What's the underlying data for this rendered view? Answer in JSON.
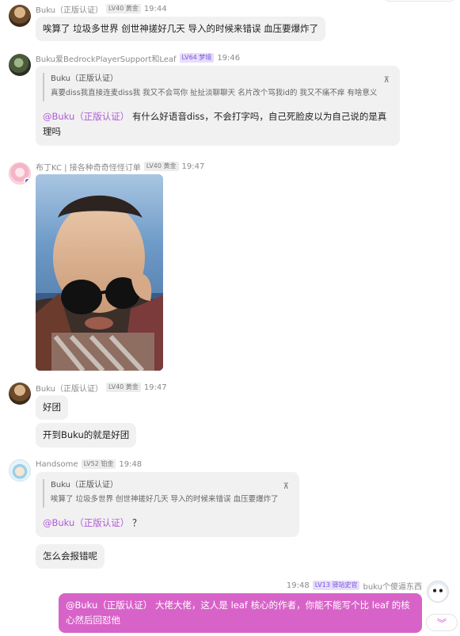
{
  "messages": [
    {
      "name": "Buku（正版认证）",
      "badge": "LV40 黄金",
      "time": "19:44",
      "text": "唉算了 垃圾多世界 创世神搓好几天 导入的时候来错误 血压要爆炸了"
    },
    {
      "name": "Buku爱BedrockPlayerSupport和Leaf",
      "badge": "LV64 梦境",
      "time": "19:46",
      "quote": {
        "name": "Buku（正版认证）",
        "text": "真要diss我直接连麦diss我 我又不会骂你 扯扯淡聊聊天 名片改个骂我id的 我又不痛不痒 有啥意义"
      },
      "mention": "@Buku（正版认证）",
      "text": "有什么好语音diss，不会打字吗，自己死脸皮以为自己说的是真理吗"
    },
    {
      "name": "布丁KC | 接各种奇奇怪怪订单",
      "badge": "LV40 黄金",
      "time": "19:47"
    },
    {
      "name": "Buku（正版认证）",
      "badge": "LV40 黄金",
      "time": "19:47",
      "lines": [
        "好团",
        "开到Buku的就是好团"
      ]
    },
    {
      "name": "Handsome",
      "badge": "LV52 铂金",
      "time": "19:48",
      "quote": {
        "name": "Buku（正版认证）",
        "text": "唉算了 垃圾多世界 创世神搓好几天 导入的时候来错误 血压要爆炸了"
      },
      "mention": "@Buku（正版认证）",
      "text": "？",
      "line2": "怎么会报错呢"
    },
    {
      "name": "buku个傻逼东西",
      "badge": "LV13 驿站史官",
      "time": "19:48",
      "mention": "@Buku（正版认证）",
      "text": "大佬大佬，这人是 leaf 核心的作者，你能不能写个比 leaf 的核心然后回怼他"
    }
  ],
  "icons": {
    "quote_jump": "pin-top-icon",
    "scroll_down": "double-chevron-down-icon"
  },
  "colors": {
    "own_bubble": "#d863c8",
    "mention": "#b05ad8",
    "other_bubble": "#f1f1f1"
  }
}
